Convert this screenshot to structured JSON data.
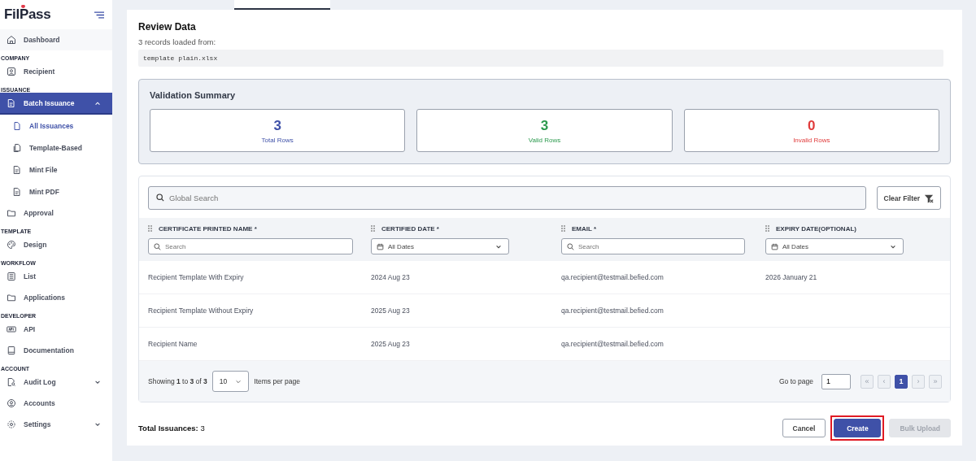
{
  "logo": "FilPass",
  "sidebar": {
    "sections": [
      {
        "items": [
          {
            "label": "Dashboard",
            "selected": false
          }
        ]
      },
      {
        "heading": "COMPANY",
        "items": [
          {
            "label": "Recipient",
            "selected": false
          }
        ]
      },
      {
        "heading": "ISSUANCE",
        "items": [
          {
            "label": "Batch Issuance",
            "selected": true,
            "expanded": true,
            "children": [
              {
                "label": "All Issuances",
                "selected": true
              },
              {
                "label": "Template-Based",
                "selected": false
              },
              {
                "label": "Mint File",
                "selected": false
              },
              {
                "label": "Mint PDF",
                "selected": false
              }
            ]
          },
          {
            "label": "Approval",
            "selected": false
          }
        ]
      },
      {
        "heading": "TEMPLATE",
        "items": [
          {
            "label": "Design",
            "selected": false
          }
        ]
      },
      {
        "heading": "WORKFLOW",
        "items": [
          {
            "label": "List",
            "selected": false
          },
          {
            "label": "Applications",
            "selected": false
          }
        ]
      },
      {
        "heading": "DEVELOPER",
        "items": [
          {
            "label": "API",
            "selected": false
          },
          {
            "label": "Documentation",
            "selected": false
          }
        ]
      },
      {
        "heading": "ACCOUNT",
        "items": [
          {
            "label": "Audit Log",
            "selected": false,
            "expanded": false
          },
          {
            "label": "Accounts",
            "selected": false
          },
          {
            "label": "Settings",
            "selected": false,
            "expanded": false
          }
        ]
      }
    ]
  },
  "title": "Review Data",
  "records_text": "3 records loaded from:",
  "file_name": "template plain.xlsx",
  "validation": {
    "title": "Validation Summary",
    "stats": [
      {
        "value": "3",
        "label": "Total Rows",
        "kind": "total"
      },
      {
        "value": "3",
        "label": "Valid Rows",
        "kind": "valid"
      },
      {
        "value": "0",
        "label": "Invalid Rows",
        "kind": "invalid"
      }
    ]
  },
  "table": {
    "search": {
      "placeholder": "Global Search"
    },
    "clear_filter": "Clear Filter",
    "columns": [
      {
        "label": "CERTIFICATE PRINTED NAME *",
        "filter": {
          "kind": "text",
          "placeholder": "Search"
        }
      },
      {
        "label": "CERTIFIED DATE *",
        "filter": {
          "kind": "date",
          "value": "All Dates"
        }
      },
      {
        "label": "EMAIL *",
        "filter": {
          "kind": "text",
          "placeholder": "Search"
        }
      },
      {
        "label": "EXPIRY DATE(OPTIONAL)",
        "filter": {
          "kind": "date",
          "value": "All Dates"
        }
      }
    ],
    "rows": [
      {
        "name": "Recipient Template With Expiry",
        "certified_date": "2024 Aug 23",
        "email": "qa.recipient@testmail.befied.com",
        "expiry_date": "2026 January 21"
      },
      {
        "name": "Recipient Template Without Expiry",
        "certified_date": "2025 Aug 23",
        "email": "qa.recipient@testmail.befied.com"
      },
      {
        "name": "Recipient Name",
        "certified_date": "2025 Aug 23",
        "email": "qa.recipient@testmail.befied.com"
      }
    ],
    "pagination": {
      "summary": "Showing **1** to **3** of **3**",
      "page_size": "10",
      "page_size_label": "Items per page",
      "goto_label": "Go to page",
      "goto_value": "1",
      "pages": [
        {
          "label": "«",
          "selected": false,
          "disabled": true
        },
        {
          "label": "‹",
          "selected": false,
          "disabled": true
        },
        {
          "label": "1",
          "selected": true,
          "disabled": false
        },
        {
          "label": "›",
          "selected": false,
          "disabled": true
        },
        {
          "label": "»",
          "selected": false,
          "disabled": true
        }
      ]
    }
  },
  "total": {
    "label": "Total Issuances:",
    "value": "3"
  },
  "buttons": [
    {
      "label": "Cancel",
      "kind": "secondary",
      "disabled": false,
      "highlighted": false
    },
    {
      "label": "Create",
      "kind": "primary",
      "disabled": false,
      "highlighted": true
    },
    {
      "label": "Bulk Upload",
      "kind": "secondary",
      "disabled": true,
      "highlighted": false
    }
  ]
}
